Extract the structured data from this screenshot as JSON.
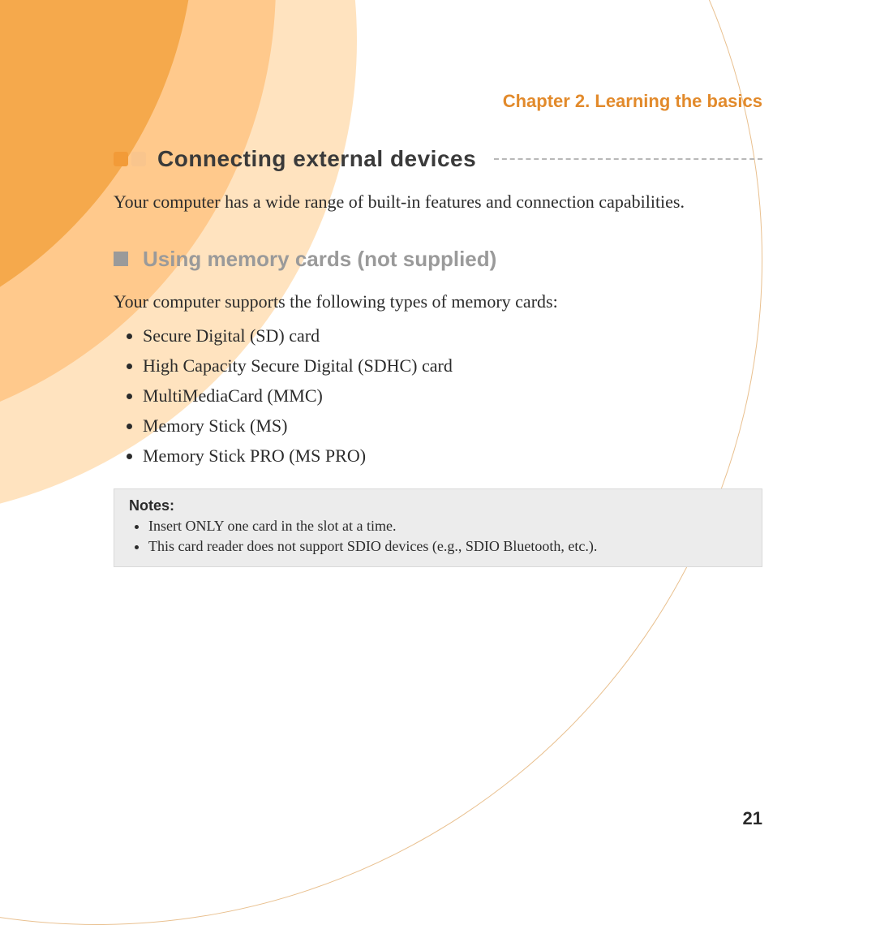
{
  "chapter": "Chapter 2. Learning the basics",
  "section": {
    "title": "Connecting external devices",
    "intro": "Your computer has a wide range of built-in features and connection capabilities."
  },
  "subsection": {
    "title": "Using memory cards (not supplied)",
    "lead": "Your computer supports the following types of memory cards:",
    "cards": [
      "Secure Digital (SD) card",
      "High Capacity Secure Digital (SDHC) card",
      "MultiMediaCard (MMC)",
      "Memory Stick (MS)",
      "Memory Stick PRO (MS PRO)"
    ]
  },
  "notes": {
    "label": "Notes:",
    "items": [
      "Insert ONLY one card in the slot at a time.",
      "This card reader does not support SDIO devices (e.g., SDIO Bluetooth, etc.)."
    ]
  },
  "page_number": "21"
}
